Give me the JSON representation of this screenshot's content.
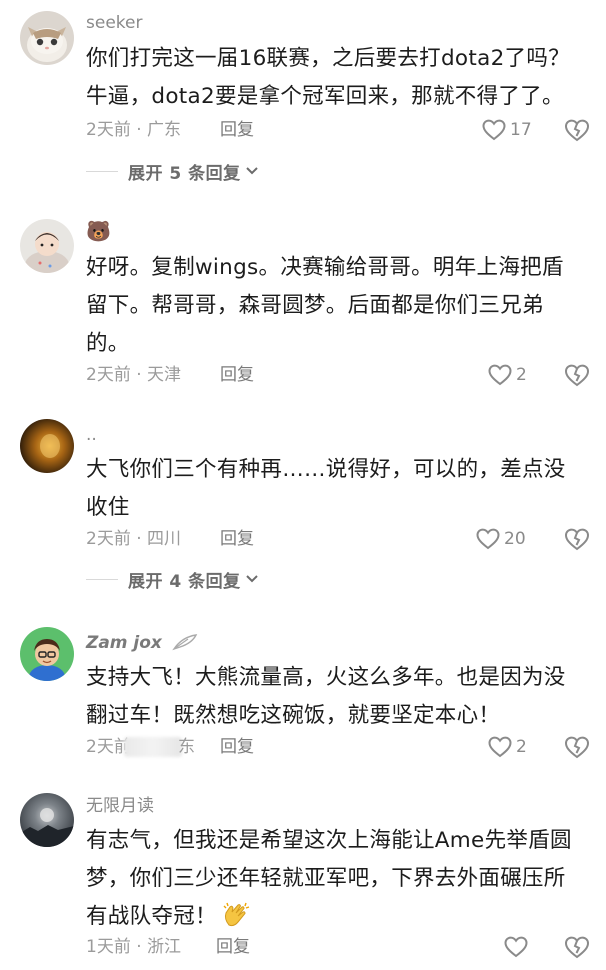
{
  "comments": [
    {
      "username": "seeker",
      "text": "你们打完这一届16联赛，之后要去打dota2了吗？牛逼，dota2要是拿个冠军回来，那就不得了了。",
      "meta": "2天前 · 广东",
      "reply_label": "回复",
      "likes": "17",
      "expand": "展开 5 条回复"
    },
    {
      "username": "🐻",
      "text": "好呀。复制wings。决赛输给哥哥。明年上海把盾留下。帮哥哥，森哥圆梦。后面都是你们三兄弟的。",
      "meta": "2天前 · 天津",
      "reply_label": "回复",
      "likes": "2"
    },
    {
      "username": "..",
      "text": "大飞你们三个有种再……说得好，可以的，差点没收住",
      "meta": "2天前 · 四川",
      "reply_label": "回复",
      "likes": "20",
      "expand": "展开 4 条回复"
    },
    {
      "username": "Zam jox",
      "text": "支持大飞！大熊流量高，火这么多年。也是因为没翻过车！既然想吃这碗饭，就要坚定本心！",
      "meta_prefix": "2天前",
      "meta_suffix": "东",
      "reply_label": "回复",
      "likes": "2"
    },
    {
      "username": "无限月读",
      "text": "有志气，但我还是希望这次上海能让Ame先举盾圆梦，你们三少还年轻就亚军吧，下界去外面碾压所有战队夺冠！",
      "meta": "1天前 · 浙江",
      "reply_label": "回复",
      "likes": ""
    }
  ],
  "icons": {
    "like": "heart-outline-icon",
    "dislike": "broken-heart-icon",
    "expand": "chevron-down-icon",
    "clap": "clapping-hands-emoji"
  },
  "colors": {
    "text": "#1c1c1c",
    "meta": "#9b9b9b",
    "username": "#8a8a8a",
    "icon": "#8a8a8a"
  }
}
